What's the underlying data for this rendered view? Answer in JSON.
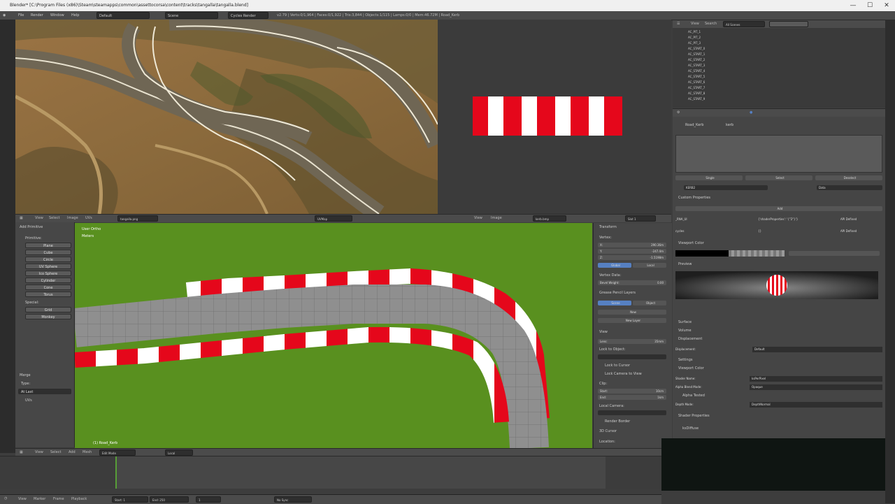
{
  "window": {
    "title": "Blender* [C:\\Program Files (x86)\\Steam\\steamapps\\common\\assettocorsa\\content\\tracks\\tangalla\\tangalla.blend]",
    "minimize": "—",
    "maximize": "☐",
    "close": "✕"
  },
  "info_header": {
    "menus": [
      "File",
      "Render",
      "Window",
      "Help"
    ],
    "layout": "Default",
    "scene": "Scene",
    "engine": "Cycles Render",
    "stats": "v2.79 | Verts:0/1,964 | Faces:0/1,922 | Tris:3,844 | Objects:1/115 | Lamps:0/0 | Mem:46.72M | Road_Kerb"
  },
  "image_editor_header": {
    "menus": [
      "View",
      "Select",
      "Image",
      "UVs"
    ],
    "image_name": "tangalla.png",
    "image_name_2": "UVMap",
    "image_menus": [
      "View",
      "Image"
    ],
    "uv_image": "kerb.bmp",
    "layer": "Slot 1"
  },
  "tool_shelf": {
    "panel_title": "Add Primitive",
    "section_primitives": "Primitive:",
    "buttons": [
      "Plane",
      "Cube",
      "Circle",
      "UV Sphere",
      "Ico Sphere",
      "Cylinder",
      "Cone",
      "Torus"
    ],
    "section_special": "Special:",
    "special_buttons": [
      "Grid",
      "Monkey"
    ],
    "merge_title": "Merge",
    "merge_type_label": "Type:",
    "merge_type_value": "At Last",
    "merge_uvs": "UVs"
  },
  "viewport": {
    "view_name": "User Ortho",
    "units": "Meters",
    "object_label": "(1) Road_Kerb",
    "header_menus": [
      "View",
      "Select",
      "Add",
      "Mesh"
    ],
    "mode": "Edit Mode",
    "pivot": "Local"
  },
  "n_panel": {
    "transform_title": "Transform",
    "vertex_label": "Vertex:",
    "x": "X:",
    "x_val": "290.36m",
    "y": "Y:",
    "y_val": "-247.4m",
    "z": "Z:",
    "z_val": "-1.5198m",
    "global": "Global",
    "local": "Local",
    "vertex_data": "Vertex Data:",
    "bevel_weight": "Bevel Weight:",
    "bevel_val": "0.00",
    "grease_pencil": "Grease Pencil Layers",
    "scene_btn": "Scene",
    "object_btn": "Object",
    "new_btn": "New",
    "new_layer": "New Layer",
    "view_title": "View",
    "lens": "Lens:",
    "lens_val": "35mm",
    "lock_to_object": "Lock to Object:",
    "lock_cursor": "Lock to Cursor",
    "lock_camera": "Lock Camera to View",
    "clip": "Clip:",
    "start": "Start:",
    "start_val": "10cm",
    "end": "End:",
    "end_val": "1km",
    "local_camera": "Local Camera:",
    "render_border": "Render Border",
    "cursor_title": "3D Cursor",
    "location": "Location:"
  },
  "outliner": {
    "menus": [
      "View",
      "Search"
    ],
    "scene_filter": "All Scenes",
    "items": [
      "AC_PIT_1",
      "AC_PIT_2",
      "AC_PIT_3",
      "AC_START_0",
      "AC_START_1",
      "AC_START_2",
      "AC_START_3",
      "AC_START_4",
      "AC_START_5",
      "AC_START_6",
      "AC_START_7",
      "AC_START_8",
      "AC_START_9"
    ]
  },
  "properties": {
    "breadcrumb_1": "Road_Kerb",
    "breadcrumb_2": "kerb",
    "tabs_row": [
      "Single",
      "Select",
      "Deselect"
    ],
    "material_name": "KERB2",
    "data_btn": "Data",
    "custom_props": "Custom Properties",
    "add_btn": "Add",
    "prop1_name": "_RNA_UI",
    "prop1_val": "{'shaderProperties': '{\"2\"}'}",
    "prop1_api": "API Defined",
    "prop2_name": "cycles",
    "prop2_val": "{}",
    "prop2_api": "API Defined",
    "preview_title": "Preview",
    "viewport_color": "Viewport Color",
    "surface": "Surface",
    "volume": "Volume",
    "displacement": "Displacement",
    "displacement_label": "Displacement:",
    "displacement_val": "Default",
    "settings": "Settings",
    "viewport_color2": "Viewport Color",
    "shader_name_label": "Shader Name:",
    "shader_name_val": "ksPerPixel",
    "alpha_blend_label": "Alpha Blend Mode:",
    "alpha_blend_val": "Opaque",
    "alpha_tested": "Alpha Tested",
    "depth_mode_label": "Depth Mode:",
    "depth_mode_val": "DepthNormal",
    "shader_props": "Shader Properties",
    "ksdiffuse": "ksDiffuse"
  },
  "timeline": {
    "menus": [
      "View",
      "Marker",
      "Frame",
      "Playback"
    ],
    "start_label": "Start:",
    "start_val": "1",
    "end_label": "End:",
    "end_val": "250",
    "current": "1",
    "sync": "No Sync"
  },
  "colors": {
    "kerb_red": "#e5071b",
    "kerb_white": "#ffffff",
    "grass": "#59901f",
    "road": "#8f8f8f",
    "blender_bg": "#3d3d3d",
    "accent_blue": "#5680c2"
  }
}
